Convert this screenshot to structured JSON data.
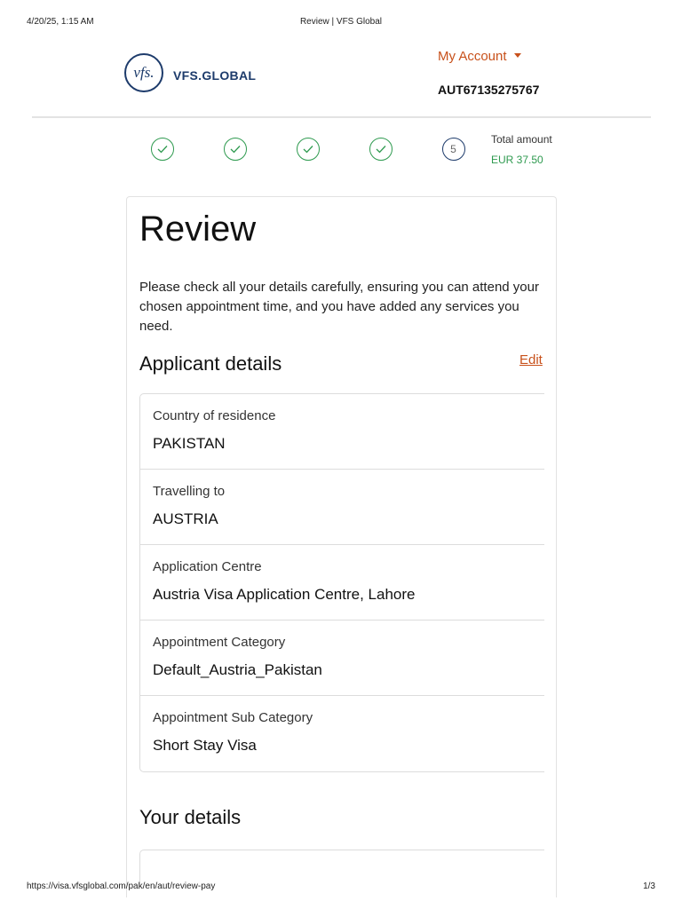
{
  "print_header": {
    "datetime": "4/20/25, 1:15 AM",
    "page_title": "Review | VFS Global"
  },
  "brand": {
    "logo_mark": "vfs.",
    "name": "VFS.GLOBAL"
  },
  "account": {
    "label": "My Account",
    "reference": "AUT67135275767"
  },
  "progress": {
    "current_step": "5",
    "total_label": "Total amount",
    "total_value": "EUR 37.50"
  },
  "review": {
    "title": "Review",
    "intro": "Please check all your details carefully, ensuring you can attend your chosen appointment time, and you have added any services you need.",
    "applicant_section": "Applicant details",
    "edit_label": "Edit",
    "details": [
      {
        "label": "Country of residence",
        "value": "PAKISTAN"
      },
      {
        "label": "Travelling to",
        "value": "AUSTRIA"
      },
      {
        "label": "Application Centre",
        "value": "Austria Visa Application Centre, Lahore"
      },
      {
        "label": "Appointment Category",
        "value": "Default_Austria_Pakistan"
      },
      {
        "label": "Appointment Sub Category",
        "value": "Short Stay Visa"
      }
    ],
    "your_details_section": "Your details"
  },
  "print_footer": {
    "url": "https://visa.vfsglobal.com/pak/en/aut/review-pay",
    "page": "1/3"
  },
  "colors": {
    "brand_blue": "#1d3b6b",
    "accent_orange": "#c8511b",
    "success_green": "#2e9a4f"
  },
  "icons": {
    "completed_step": "check-circle-icon",
    "account_caret": "caret-down-icon"
  }
}
